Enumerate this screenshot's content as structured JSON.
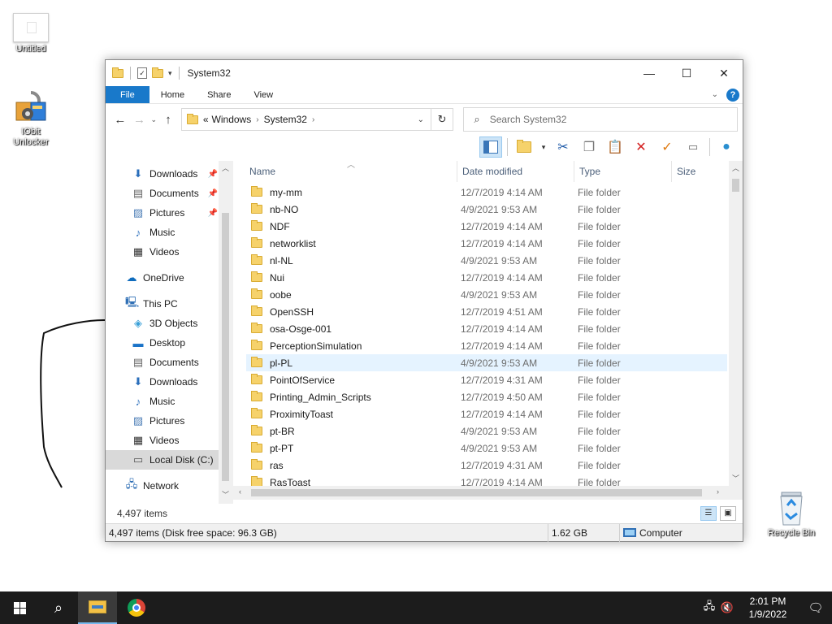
{
  "desktop": {
    "icons": [
      {
        "label": "Untitled"
      },
      {
        "label": "IObit Unlocker"
      },
      {
        "label": "Recycle Bin"
      }
    ]
  },
  "window": {
    "title": "System32",
    "ribbon_tabs": [
      "File",
      "Home",
      "Share",
      "View"
    ],
    "address": {
      "prefix": "«",
      "crumbs": [
        "Windows",
        "System32"
      ]
    },
    "search_placeholder": "Search System32",
    "nav_items": [
      {
        "label": "Downloads",
        "icon": "download-arrow-icon",
        "pinned": true
      },
      {
        "label": "Documents",
        "icon": "documents-icon",
        "pinned": true
      },
      {
        "label": "Pictures",
        "icon": "pictures-icon",
        "pinned": true
      },
      {
        "label": "Music",
        "icon": "music-note-icon",
        "pinned": false
      },
      {
        "label": "Videos",
        "icon": "videos-icon",
        "pinned": false
      },
      {
        "label": "OneDrive",
        "icon": "cloud-icon",
        "pinned": false
      },
      {
        "label": "This PC",
        "icon": "computer-icon",
        "pinned": false
      },
      {
        "label": "3D Objects",
        "icon": "cube-icon",
        "pinned": false
      },
      {
        "label": "Desktop",
        "icon": "desktop-icon",
        "pinned": false
      },
      {
        "label": "Documents",
        "icon": "documents-icon",
        "pinned": false
      },
      {
        "label": "Downloads",
        "icon": "download-arrow-icon",
        "pinned": false
      },
      {
        "label": "Music",
        "icon": "music-note-icon",
        "pinned": false
      },
      {
        "label": "Pictures",
        "icon": "pictures-icon",
        "pinned": false
      },
      {
        "label": "Videos",
        "icon": "videos-icon",
        "pinned": false
      },
      {
        "label": "Local Disk (C:)",
        "icon": "drive-icon",
        "pinned": false,
        "selected": true
      },
      {
        "label": "Network",
        "icon": "network-icon",
        "pinned": false
      }
    ],
    "columns": [
      "Name",
      "Date modified",
      "Type",
      "Size"
    ],
    "files": [
      {
        "name": "my-mm",
        "date": "12/7/2019 4:14 AM",
        "type": "File folder"
      },
      {
        "name": "nb-NO",
        "date": "4/9/2021 9:53 AM",
        "type": "File folder"
      },
      {
        "name": "NDF",
        "date": "12/7/2019 4:14 AM",
        "type": "File folder"
      },
      {
        "name": "networklist",
        "date": "12/7/2019 4:14 AM",
        "type": "File folder"
      },
      {
        "name": "nl-NL",
        "date": "4/9/2021 9:53 AM",
        "type": "File folder"
      },
      {
        "name": "Nui",
        "date": "12/7/2019 4:14 AM",
        "type": "File folder"
      },
      {
        "name": "oobe",
        "date": "4/9/2021 9:53 AM",
        "type": "File folder"
      },
      {
        "name": "OpenSSH",
        "date": "12/7/2019 4:51 AM",
        "type": "File folder"
      },
      {
        "name": "osa-Osge-001",
        "date": "12/7/2019 4:14 AM",
        "type": "File folder"
      },
      {
        "name": "PerceptionSimulation",
        "date": "12/7/2019 4:14 AM",
        "type": "File folder"
      },
      {
        "name": "pl-PL",
        "date": "4/9/2021 9:53 AM",
        "type": "File folder",
        "highlight": true
      },
      {
        "name": "PointOfService",
        "date": "12/7/2019 4:31 AM",
        "type": "File folder"
      },
      {
        "name": "Printing_Admin_Scripts",
        "date": "12/7/2019 4:50 AM",
        "type": "File folder"
      },
      {
        "name": "ProximityToast",
        "date": "12/7/2019 4:14 AM",
        "type": "File folder"
      },
      {
        "name": "pt-BR",
        "date": "4/9/2021 9:53 AM",
        "type": "File folder"
      },
      {
        "name": "pt-PT",
        "date": "4/9/2021 9:53 AM",
        "type": "File folder"
      },
      {
        "name": "ras",
        "date": "12/7/2019 4:31 AM",
        "type": "File folder"
      },
      {
        "name": "RasToast",
        "date": "12/7/2019 4:14 AM",
        "type": "File folder"
      }
    ],
    "item_count": "4,497 items",
    "status": {
      "left": "4,497 items (Disk free space: 96.3 GB)",
      "size": "1.62 GB",
      "location": "Computer"
    }
  },
  "taskbar": {
    "time": "2:01 PM",
    "date": "1/9/2022"
  },
  "colors": {
    "accent": "#1979ca",
    "folder": "#f6d26b",
    "row_highlight": "#e5f3ff",
    "taskbar": "#1c1c1c"
  }
}
